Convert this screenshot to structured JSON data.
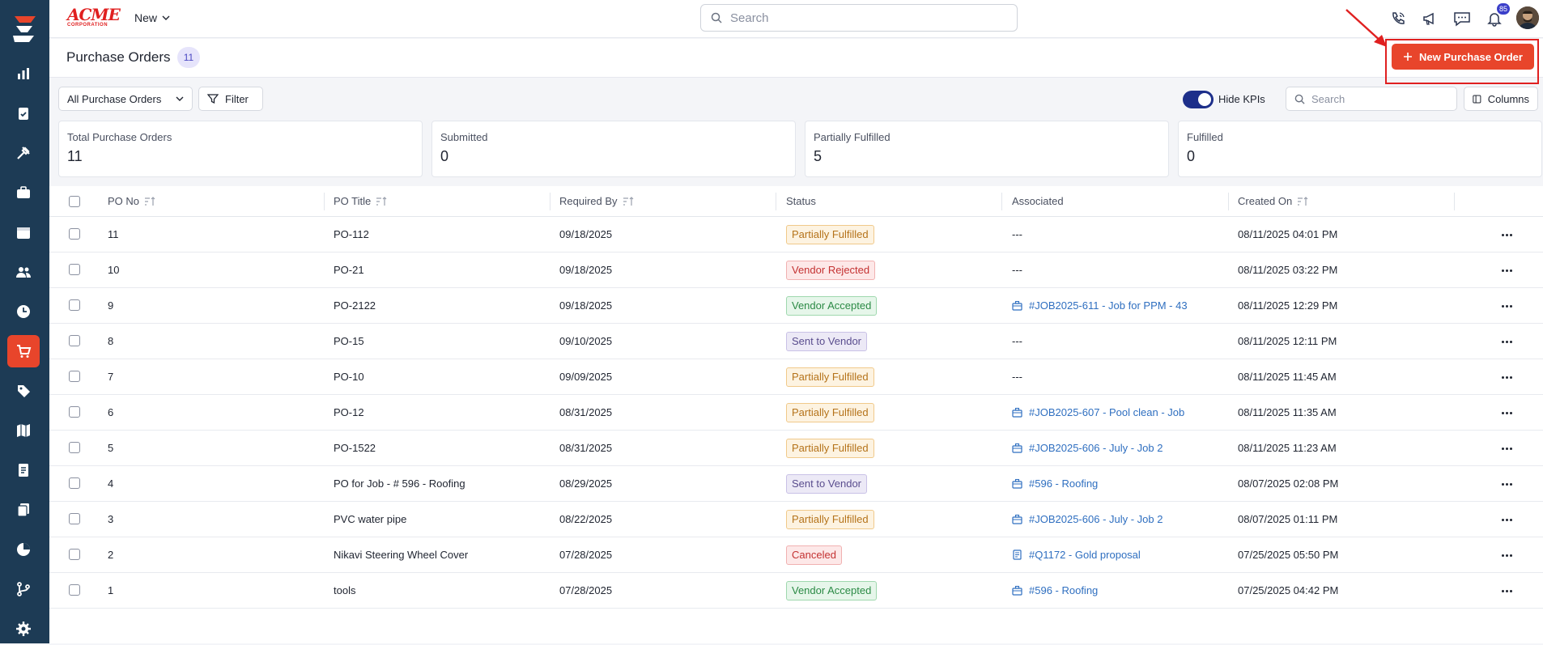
{
  "header": {
    "brand": "ACME",
    "brand_sub": "CORPORATION",
    "new_label": "New",
    "search_placeholder": "Search",
    "notification_count": "85"
  },
  "page": {
    "title": "Purchase Orders",
    "count": "11",
    "new_button_label": "New Purchase Order"
  },
  "toolbar": {
    "view_label": "All Purchase Orders",
    "filter_label": "Filter",
    "hide_kpis_label": "Hide KPIs",
    "search_placeholder": "Search",
    "columns_label": "Columns"
  },
  "kpis": [
    {
      "label": "Total Purchase Orders",
      "value": "11"
    },
    {
      "label": "Submitted",
      "value": "0"
    },
    {
      "label": "Partially Fulfilled",
      "value": "5"
    },
    {
      "label": "Fulfilled",
      "value": "0"
    }
  ],
  "table": {
    "columns": [
      "PO No",
      "PO Title",
      "Required By",
      "Status",
      "Associated",
      "Created On"
    ],
    "rows": [
      {
        "no": "11",
        "title": "PO-112",
        "required": "09/18/2025",
        "status": "Partially Fulfilled",
        "assoc": "---",
        "created": "08/11/2025 04:01 PM"
      },
      {
        "no": "10",
        "title": "PO-21",
        "required": "09/18/2025",
        "status": "Vendor Rejected",
        "assoc": "---",
        "created": "08/11/2025 03:22 PM"
      },
      {
        "no": "9",
        "title": "PO-2122",
        "required": "09/18/2025",
        "status": "Vendor Accepted",
        "assoc": "#JOB2025-611 - Job for PPM - 43",
        "created": "08/11/2025 12:29 PM"
      },
      {
        "no": "8",
        "title": "PO-15",
        "required": "09/10/2025",
        "status": "Sent to Vendor",
        "assoc": "---",
        "created": "08/11/2025 12:11 PM"
      },
      {
        "no": "7",
        "title": "PO-10",
        "required": "09/09/2025",
        "status": "Partially Fulfilled",
        "assoc": "---",
        "created": "08/11/2025 11:45 AM"
      },
      {
        "no": "6",
        "title": "PO-12",
        "required": "08/31/2025",
        "status": "Partially Fulfilled",
        "assoc": "#JOB2025-607 - Pool clean - Job",
        "created": "08/11/2025 11:35 AM"
      },
      {
        "no": "5",
        "title": "PO-1522",
        "required": "08/31/2025",
        "status": "Partially Fulfilled",
        "assoc": "#JOB2025-606 - July - Job 2",
        "created": "08/11/2025 11:23 AM"
      },
      {
        "no": "4",
        "title": "PO for Job - # 596 - Roofing",
        "required": "08/29/2025",
        "status": "Sent to Vendor",
        "assoc": "#596 - Roofing",
        "created": "08/07/2025 02:08 PM"
      },
      {
        "no": "3",
        "title": "PVC water pipe",
        "required": "08/22/2025",
        "status": "Partially Fulfilled",
        "assoc": "#JOB2025-606 - July - Job 2",
        "created": "08/07/2025 01:11 PM"
      },
      {
        "no": "2",
        "title": "Nikavi Steering Wheel Cover",
        "required": "07/28/2025",
        "status": "Canceled",
        "assoc": "#Q1172 - Gold proposal",
        "created": "07/25/2025 05:50 PM"
      },
      {
        "no": "1",
        "title": "tools",
        "required": "07/28/2025",
        "status": "Vendor Accepted",
        "assoc": "#596 - Roofing",
        "created": "07/25/2025 04:42 PM"
      }
    ]
  },
  "colors": {
    "sidebar": "#1d3b55",
    "accent": "#e8452b",
    "toggle": "#1d2f8a",
    "link": "#2f6fc0"
  }
}
